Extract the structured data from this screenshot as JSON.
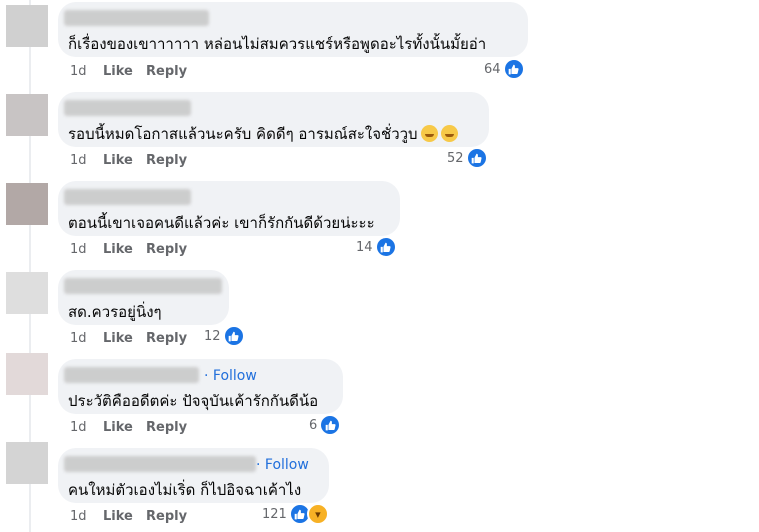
{
  "comments": [
    {
      "text": "ก็เรื่องของเขาาาาาา หล่อนไม่สมควรแชร์หรือพูดอะไรทั้งนั้นมั้ยอ่า",
      "time": "1d",
      "like": "Like",
      "reply": "Reply",
      "reactions": "64",
      "follow": ""
    },
    {
      "text": "รอบนี้หมดโอกาสแล้วนะครับ คิดดีๆ อารมณ์สะใจชั่ววูบ",
      "time": "1d",
      "like": "Like",
      "reply": "Reply",
      "reactions": "52",
      "follow": ""
    },
    {
      "text": "ตอนนี้เขาเจอคนดีแล้วค่ะ เขาก็รักกันดีด้วยน่ะะะ",
      "time": "1d",
      "like": "Like",
      "reply": "Reply",
      "reactions": "14",
      "follow": ""
    },
    {
      "text": "สด.ควรอยู่นิ่งๆ",
      "time": "1d",
      "like": "Like",
      "reply": "Reply",
      "reactions": "12",
      "follow": ""
    },
    {
      "text": "ประวัติคืออดีตค่ะ ปัจจุบันเค้ารักกันดีน้อ",
      "time": "1d",
      "like": "Like",
      "reply": "Reply",
      "reactions": "6",
      "follow": "· Follow"
    },
    {
      "text": "คนใหม่ตัวเองไม่เริ่ด ก็ไปอิจฉาเค้าไง",
      "time": "1d",
      "like": "Like",
      "reply": "Reply",
      "reactions": "121",
      "follow": "· Follow"
    }
  ],
  "icons": {
    "like": "like-reaction-icon",
    "haha": "haha-reaction-icon",
    "emoji": "thinking-emoji"
  },
  "colors": {
    "bubble": "#f0f2f5",
    "link": "#216fdb",
    "like_blue": "#1b74e4",
    "meta": "#65676b"
  }
}
